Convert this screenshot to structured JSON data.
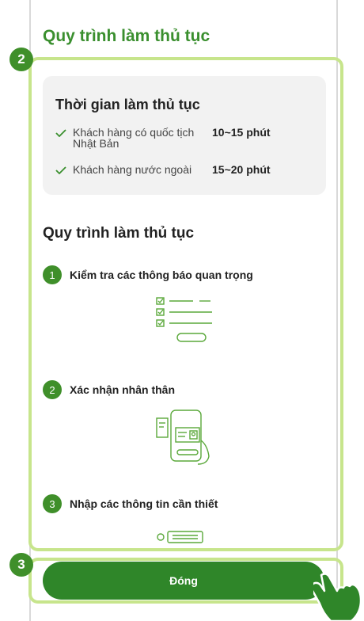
{
  "page": {
    "title": "Quy trình làm thủ tục"
  },
  "annotations": {
    "badge_2": "2",
    "badge_3": "3"
  },
  "time_card": {
    "title": "Thời gian làm thủ tục",
    "rows": [
      {
        "customer": "Khách hàng có quốc tịch Nhật Bản",
        "duration": "10~15 phút"
      },
      {
        "customer": "Khách hàng nước ngoài",
        "duration": "15~20 phút"
      }
    ]
  },
  "procedure": {
    "title": "Quy trình làm thủ tục",
    "steps": [
      {
        "number": "1",
        "label": "Kiểm tra các thông báo quan trọng",
        "icon": "checklist-icon"
      },
      {
        "number": "2",
        "label": "Xác nhận nhân thân",
        "icon": "id-phone-icon"
      },
      {
        "number": "3",
        "label": "Nhập các thông tin cần thiết",
        "icon": "input-form-icon"
      }
    ]
  },
  "footer": {
    "close_label": "Đóng"
  },
  "colors": {
    "accent": "#2f8629",
    "highlight": "#c7e58c",
    "card_bg": "#f2f2f2"
  }
}
